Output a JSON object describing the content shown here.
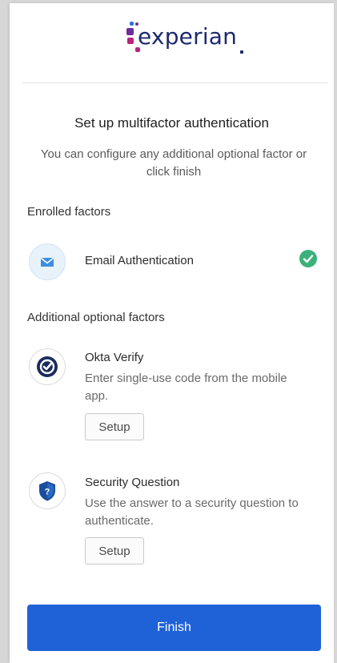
{
  "brand": {
    "logo_text": "experian",
    "colors": {
      "navy": "#1c2a6c",
      "magenta": "#b8247a",
      "purple": "#6a2f9c",
      "blue": "#2e6fd6"
    }
  },
  "header": {
    "title": "Set up multifactor authentication",
    "subtitle": "You can configure any additional optional factor or click finish"
  },
  "enrolled": {
    "heading": "Enrolled factors",
    "factors": [
      {
        "name": "Email Authentication",
        "icon": "email-icon",
        "status": "enrolled",
        "status_icon": "checkmark-icon"
      }
    ]
  },
  "optional": {
    "heading": "Additional optional factors",
    "factors": [
      {
        "name": "Okta Verify",
        "description": "Enter single-use code from the mobile app.",
        "icon": "okta-verify-icon",
        "button_label": "Setup"
      },
      {
        "name": "Security Question",
        "description": "Use the answer to a security question to authenticate.",
        "icon": "security-question-icon",
        "button_label": "Setup"
      }
    ]
  },
  "footer": {
    "finish_label": "Finish"
  },
  "colors": {
    "primary_button": "#1f62d8",
    "success_check": "#3bb07a"
  }
}
